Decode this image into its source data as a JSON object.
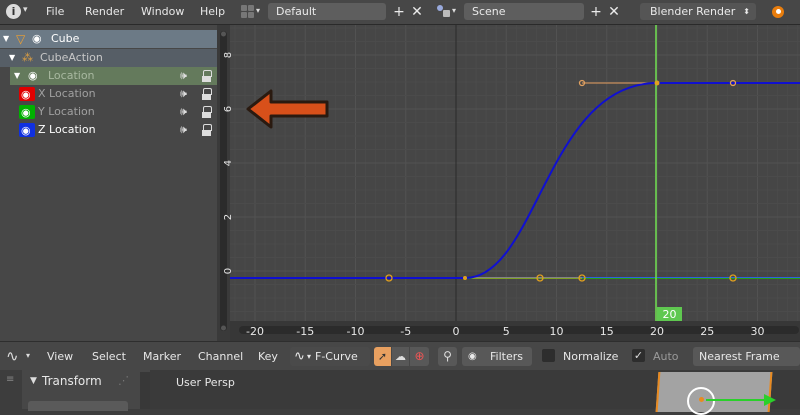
{
  "topbar": {
    "menus": [
      "File",
      "Render",
      "Window",
      "Help"
    ],
    "screen_layout": "Default",
    "scene": "Scene",
    "render_engine": "Blender Render"
  },
  "channels": {
    "object": "Cube",
    "action": "CubeAction",
    "group": "Location",
    "items": [
      {
        "label": "X Location",
        "color": "#e00000"
      },
      {
        "label": "Y Location",
        "color": "#00b000"
      },
      {
        "label": "Z Location",
        "color": "#1030e0"
      }
    ]
  },
  "graph": {
    "x_ticks": [
      "-20",
      "-15",
      "-10",
      "-5",
      "0",
      "5",
      "10",
      "15",
      "20",
      "25",
      "30"
    ],
    "y_ticks": [
      "8",
      "6",
      "4",
      "2",
      "0"
    ],
    "current_frame": "20",
    "curve_color": "#1010d0",
    "frame_line_color": "#70e050"
  },
  "header": {
    "menus": [
      "View",
      "Select",
      "Marker",
      "Channel",
      "Key"
    ],
    "mode": "F-Curve",
    "filters": "Filters",
    "normalize": "Normalize",
    "auto": "Auto",
    "snap": "Nearest Frame"
  },
  "bottom": {
    "panel_title": "Transform",
    "viewport_label": "User Persp"
  }
}
